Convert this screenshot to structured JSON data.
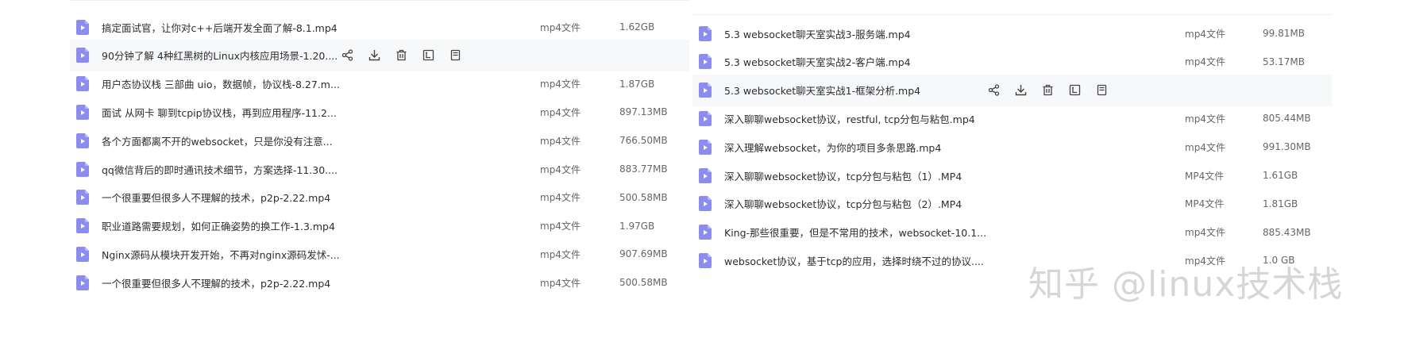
{
  "colors": {
    "accent": "#8c8cf0",
    "hover_bg": "#f7f8fa",
    "text": "#2d2d2d",
    "meta": "#666666"
  },
  "left_panel": {
    "files": [
      {
        "name": "搞定面试官，让你对c++后端开发全面了解-8.1.mp4",
        "type": "mp4文件",
        "size": "1.62GB"
      },
      {
        "name": "90分钟了解 4种红黑树的Linux内核应用场景-1.20....",
        "type": "",
        "size": "",
        "hover": true
      },
      {
        "name": "用户态协议栈 三部曲 uio，数据帧，协议栈-8.27.m...",
        "type": "mp4文件",
        "size": "1.87GB"
      },
      {
        "name": "面试 从网卡 聊到tcpip协议栈，再到应用程序-11.2...",
        "type": "mp4文件",
        "size": "897.13MB"
      },
      {
        "name": "各个方面都离不开的websocket，只是你没有注意...",
        "type": "mp4文件",
        "size": "766.50MB"
      },
      {
        "name": "qq微信背后的即时通讯技术细节，方案选择-11.30....",
        "type": "mp4文件",
        "size": "883.77MB"
      },
      {
        "name": "一个很重要但很多人不理解的技术，p2p-2.22.mp4",
        "type": "mp4文件",
        "size": "500.58MB"
      },
      {
        "name": "职业道路需要规划，如何正确姿势的换工作-1.3.mp4",
        "type": "mp4文件",
        "size": "1.97GB"
      },
      {
        "name": "Nginx源码从模块开发开始，不再对nginx源码发怵-...",
        "type": "mp4文件",
        "size": "907.69MB"
      },
      {
        "name": "一个很重要但很多人不理解的技术，p2p-2.22.mp4",
        "type": "mp4文件",
        "size": "500.58MB"
      }
    ]
  },
  "right_panel": {
    "files": [
      {
        "name": "5.3 websocket聊天室实战3-服务端.mp4",
        "type": "mp4文件",
        "size": "99.81MB"
      },
      {
        "name": "5.3 websocket聊天室实战2-客户端.mp4",
        "type": "mp4文件",
        "size": "53.17MB"
      },
      {
        "name": "5.3 websocket聊天室实战1-框架分析.mp4",
        "type": "",
        "size": "",
        "hover": true
      },
      {
        "name": "深入聊聊websocket协议，restful, tcp分包与粘包.mp4",
        "type": "mp4文件",
        "size": "805.44MB"
      },
      {
        "name": "深入理解websocket，为你的项目多条思路.mp4",
        "type": "mp4文件",
        "size": "991.30MB"
      },
      {
        "name": "深入聊聊websocket协议，tcp分包与粘包（1）.MP4",
        "type": "MP4文件",
        "size": "1.61GB"
      },
      {
        "name": "深入聊聊websocket协议，tcp分包与粘包（2）.MP4",
        "type": "MP4文件",
        "size": "1.81GB"
      },
      {
        "name": "King-那些很重要，但是不常用的技术，websocket-10.1...",
        "type": "mp4文件",
        "size": "885.43MB"
      },
      {
        "name": "websocket协议，基于tcp的应用，选择时绕不过的协议....",
        "type": "mp4文件",
        "size": "1.0 GB"
      }
    ]
  },
  "actions": [
    {
      "icon": "share-icon"
    },
    {
      "icon": "download-icon"
    },
    {
      "icon": "delete-icon"
    },
    {
      "icon": "rename-icon"
    },
    {
      "icon": "more-icon"
    }
  ],
  "watermark": "知乎 @linux技术栈"
}
